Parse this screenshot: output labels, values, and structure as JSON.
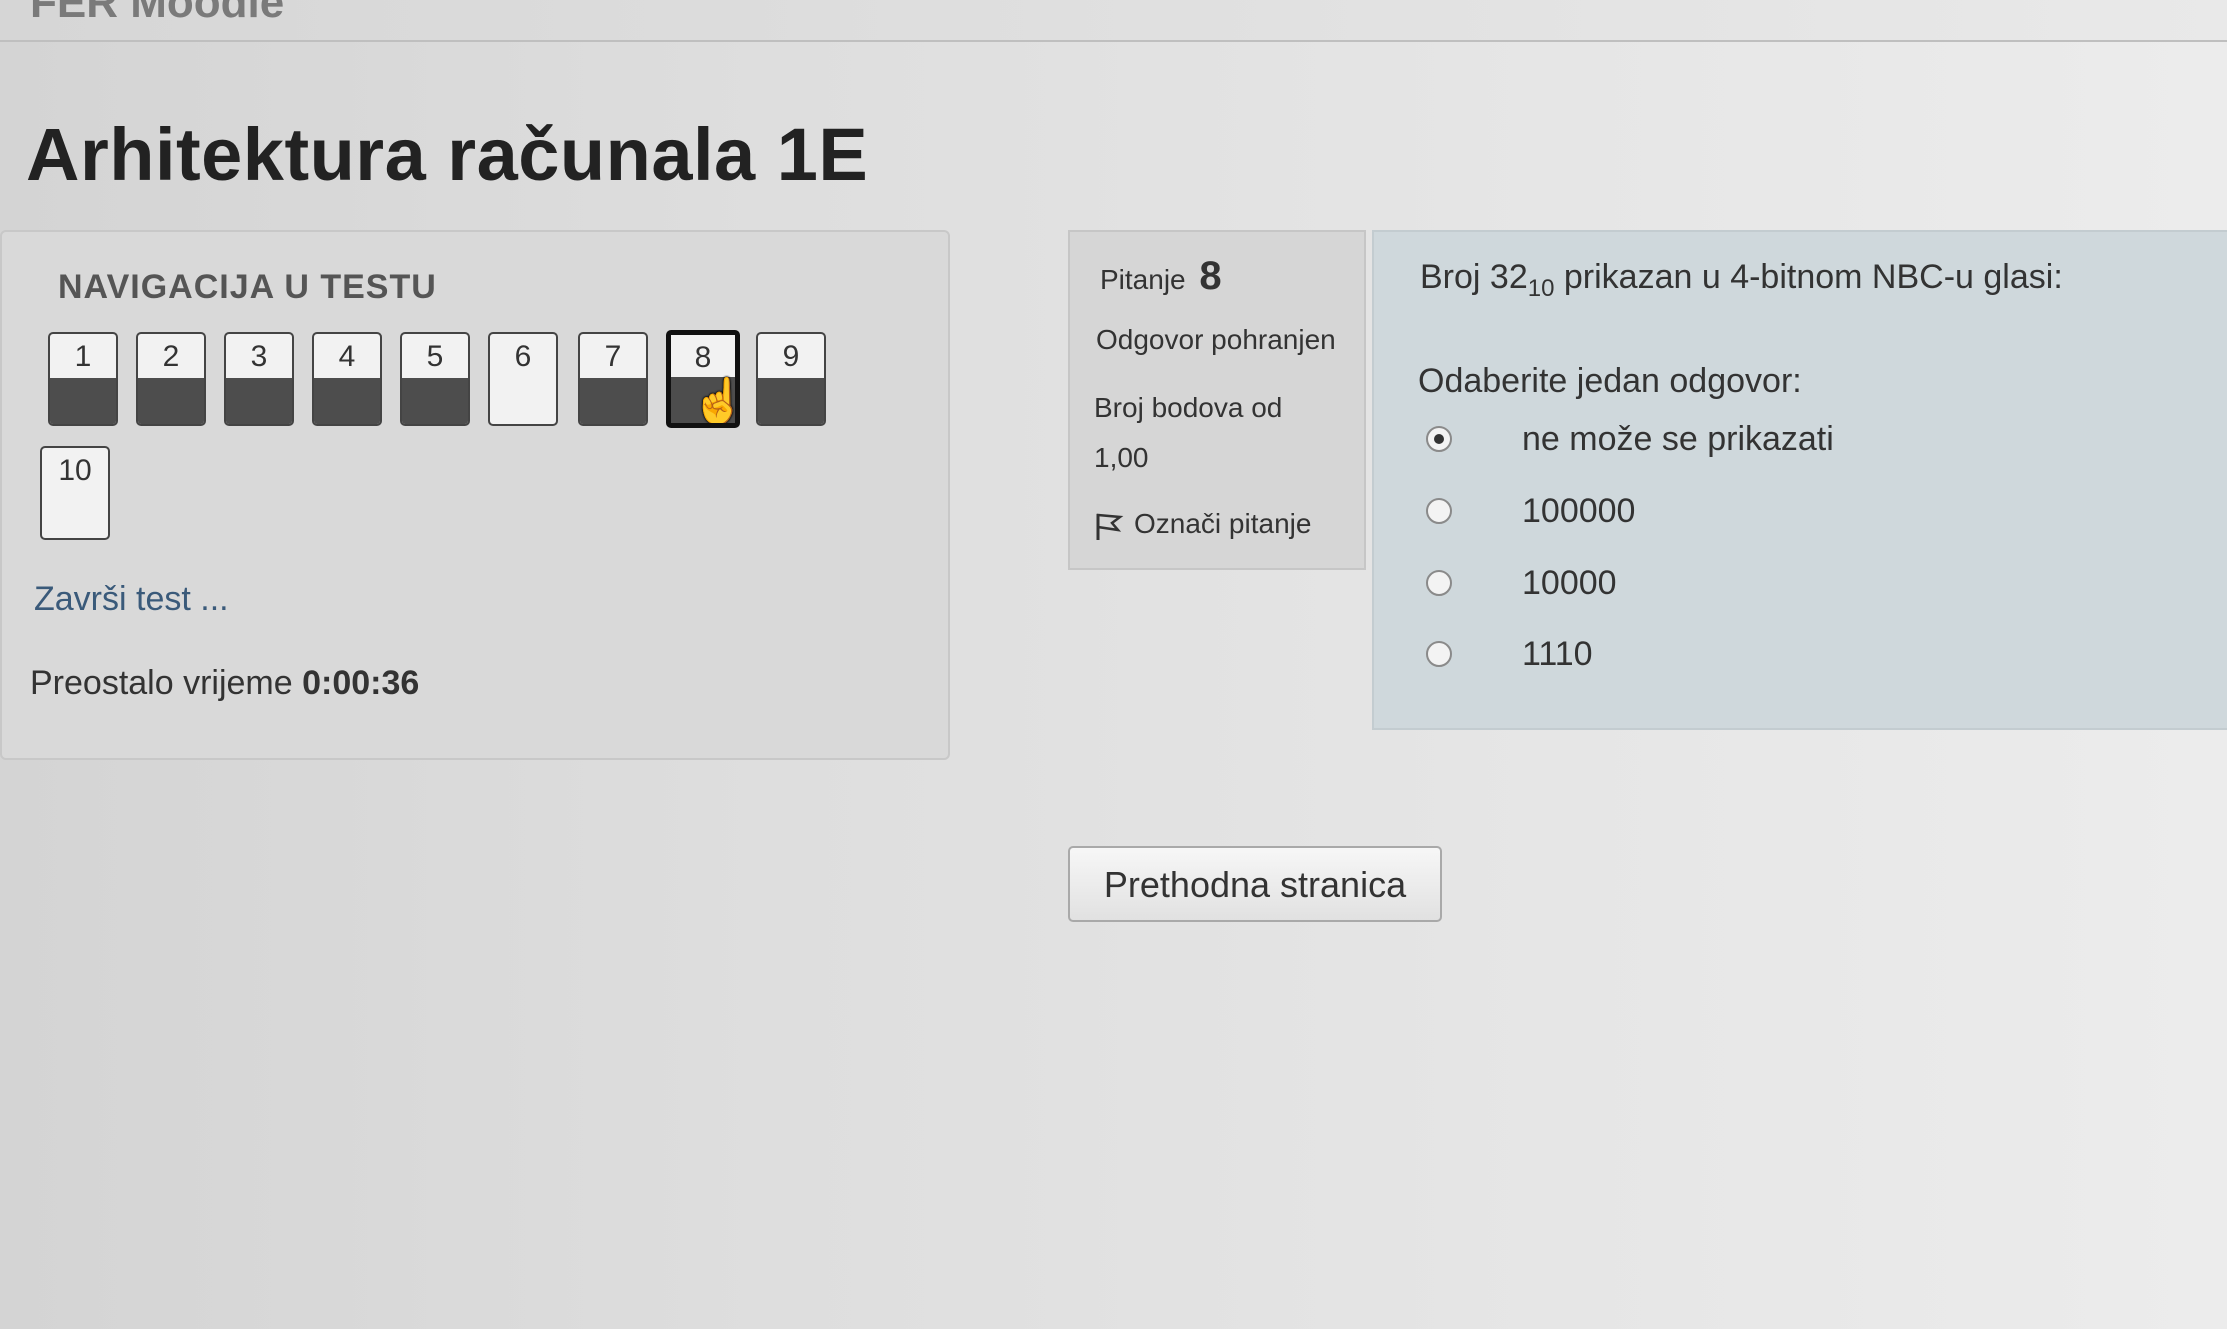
{
  "header": {
    "brand": "FER Moodle"
  },
  "page": {
    "title": "Arhitektura računala 1E"
  },
  "nav": {
    "title": "NAVIGACIJA U TESTU",
    "buttons": [
      {
        "label": "1",
        "answered": true
      },
      {
        "label": "2",
        "answered": true
      },
      {
        "label": "3",
        "answered": true
      },
      {
        "label": "4",
        "answered": true
      },
      {
        "label": "5",
        "answered": true
      },
      {
        "label": "6",
        "answered": false
      },
      {
        "label": "7",
        "answered": true
      },
      {
        "label": "8",
        "answered": true,
        "current": true
      },
      {
        "label": "9",
        "answered": true
      },
      {
        "label": "10",
        "answered": false
      }
    ],
    "finish_label": "Završi test ...",
    "time_label": "Preostalo vrijeme",
    "time_value": "0:00:36"
  },
  "info": {
    "question_label": "Pitanje",
    "question_number": "8",
    "state": "Odgovor pohranjen",
    "grade_line1": "Broj bodova od",
    "grade_line2": "1,00",
    "flag_label": "Označi pitanje"
  },
  "question": {
    "text_before": "Broj 32",
    "subscript": "10",
    "text_after": " prikazan u 4-bitnom NBC-u glasi:",
    "prompt": "Odaberite jedan odgovor:",
    "options": [
      {
        "label": "ne može se prikazati",
        "selected": true
      },
      {
        "label": "100000",
        "selected": false
      },
      {
        "label": "10000",
        "selected": false
      },
      {
        "label": "1110",
        "selected": false
      }
    ]
  },
  "footer": {
    "prev_label": "Prethodna stranica"
  }
}
